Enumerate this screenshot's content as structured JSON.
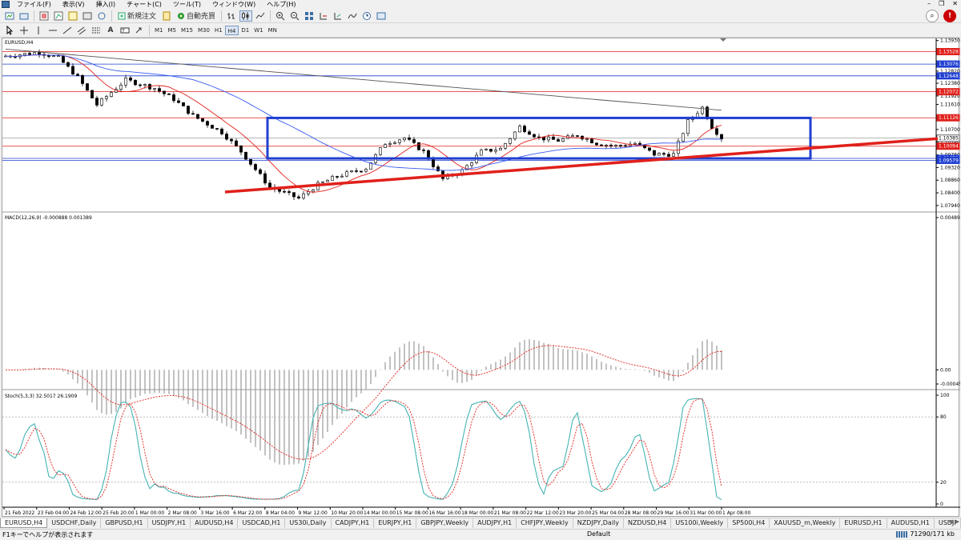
{
  "menu": {
    "items": [
      "ファイル(F)",
      "表示(V)",
      "挿入(I)",
      "チャート(C)",
      "ツール(T)",
      "ウィンドウ(W)",
      "ヘルプ(H)"
    ]
  },
  "toolbar": {
    "new_order_label": "新規注文",
    "auto_trading_label": "自動売買",
    "timeframes": [
      "M1",
      "M5",
      "M15",
      "M30",
      "H1",
      "H4",
      "D1",
      "W1",
      "MN"
    ],
    "active_timeframe": "H4"
  },
  "chart": {
    "symbol_label": "EURUSD,H4",
    "macd_label": "MACD(12,26,9) -0.000888 0.001389",
    "stoch_label": "Stoch(5,3,3) 32.5017 26.1909",
    "price_ticks": [
      "1.13930",
      "1.13490",
      "1.12820",
      "1.12380",
      "1.11920",
      "1.11610",
      "1.11160",
      "1.10700",
      "1.10240",
      "1.09780",
      "1.09320",
      "1.08860",
      "1.08400",
      "1.07940"
    ],
    "level_tags": [
      {
        "label": "1.13528",
        "color": "#e0201b"
      },
      {
        "label": "1.13076",
        "color": "#1f3fd1"
      },
      {
        "label": "1.12648",
        "color": "#1f3fd1"
      },
      {
        "label": "1.12072",
        "color": "#e0201b"
      },
      {
        "label": "1.11126",
        "color": "#e0201b"
      },
      {
        "label": "1.10385",
        "color": "#ffffff"
      },
      {
        "label": "1.10094",
        "color": "#e0201b"
      },
      {
        "label": "1.09652",
        "color": "#1f3fd1"
      },
      {
        "label": "1.09579",
        "color": "#1f3fd1"
      }
    ],
    "macd_ticks": [
      "0.004891",
      "0.00",
      "-0.000455"
    ],
    "stoch_ticks": [
      "100",
      "80",
      "20",
      "0"
    ],
    "time_labels": [
      "21 Feb 2022",
      "23 Feb 04:00",
      "24 Feb 12:00",
      "25 Feb 20:00",
      "1 Mar 00:00",
      "2 Mar 08:00",
      "3 Mar 16:00",
      "6 Mar 22:00",
      "8 Mar 04:00",
      "9 Mar 12:00",
      "10 Mar 20:00",
      "14 Mar 00:00",
      "15 Mar 08:00",
      "16 Mar 16:00",
      "18 Mar 00:00",
      "21 Mar 08:00",
      "22 Mar 12:00",
      "23 Mar 20:00",
      "25 Mar 04:00",
      "28 Mar 08:00",
      "29 Mar 16:00",
      "31 Mar 00:00",
      "1 Apr 08:00"
    ],
    "colors": {
      "bull": "#000000",
      "bear": "#000000",
      "ma_red": "#e0201b",
      "ma_blue": "#3a5cf0",
      "ma_gray": "#555555",
      "box": "#1f3fd1",
      "trendline": "#e0201b",
      "macd_signal": "#e0201b",
      "stoch_main": "#45b3b3",
      "stoch_signal": "#e0201b"
    }
  },
  "tabs": {
    "items": [
      "EURUSD,H4",
      "USDCHF,Daily",
      "GBPUSD,H1",
      "USDJPY,H1",
      "AUDUSD,H4",
      "USDCAD,H1",
      "US30i,Daily",
      "CADJPY,H1",
      "EURJPY,H1",
      "GBPJPY,Weekly",
      "AUDJPY,H1",
      "CHFJPY,Weekly",
      "NZDJPY,Daily",
      "NZDUSD,H4",
      "US100i,Weekly",
      "SP500i,H4",
      "XAUUSD_m,Weekly",
      "EURUSD,H1",
      "AUDUSD,H1",
      "USDJI"
    ],
    "active": "EURUSD,H4"
  },
  "status": {
    "help_text": "F1キーでヘルプが表示されます",
    "profile": "Default",
    "traffic": "71290/171 kb"
  }
}
